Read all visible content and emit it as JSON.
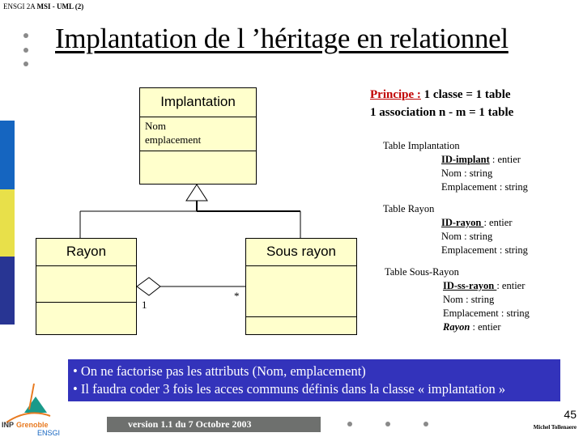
{
  "header": {
    "prefix": "ENSGI 2A ",
    "bold": "MSI - UML (2)"
  },
  "title": "Implantation de l ’héritage en relationnel",
  "sidebar_colors": {
    "top": "#1565c0",
    "middle": "#e8e04a",
    "bottom": "#283593"
  },
  "diagram": {
    "classes": [
      {
        "name": "Implantation",
        "attributes": [
          "Nom",
          "emplacement"
        ]
      },
      {
        "name": "Rayon",
        "attributes": []
      },
      {
        "name": "Sous rayon",
        "attributes": []
      }
    ],
    "association": {
      "multiplicity_left": "1",
      "multiplicity_right": "*"
    }
  },
  "principle": {
    "label": "Principe :",
    "line1": " 1 classe = 1 table",
    "line2": "1 association n - m = 1 table"
  },
  "tables": [
    {
      "title": "Table Implantation",
      "fields": [
        {
          "name": "ID-implant",
          "type": " : entier",
          "style": "pk"
        },
        {
          "name": "Nom",
          "type": " : string",
          "style": ""
        },
        {
          "name": "Emplacement",
          "type": " : string",
          "style": ""
        }
      ]
    },
    {
      "title": "Table Rayon",
      "fields": [
        {
          "name": "ID-rayon ",
          "type": ": entier",
          "style": "pk"
        },
        {
          "name": "Nom",
          "type": " : string",
          "style": ""
        },
        {
          "name": "Emplacement",
          "type": " : string",
          "style": ""
        }
      ]
    },
    {
      "title": "Table Sous-Rayon",
      "fields": [
        {
          "name": "ID-ss-rayon ",
          "type": ": entier",
          "style": "pk"
        },
        {
          "name": "Nom",
          "type": " : string",
          "style": ""
        },
        {
          "name": "Emplacement",
          "type": " : string",
          "style": ""
        },
        {
          "name": "Rayon",
          "type": " : entier",
          "style": "fk"
        }
      ]
    }
  ],
  "note": {
    "lines": [
      "• On ne factorise pas les attributs (Nom, emplacement)",
      "• Il faudra coder 3 fois les acces communs définis dans la classe « implantation »"
    ],
    "background": "#3333bb"
  },
  "footer": {
    "version": "version 1.1 du 7 Octobre 2003",
    "page_number": "45",
    "author": "Michel Tollenaere",
    "logo_text_top": "INP Grenoble",
    "logo_text_bottom": "ENSGI"
  }
}
